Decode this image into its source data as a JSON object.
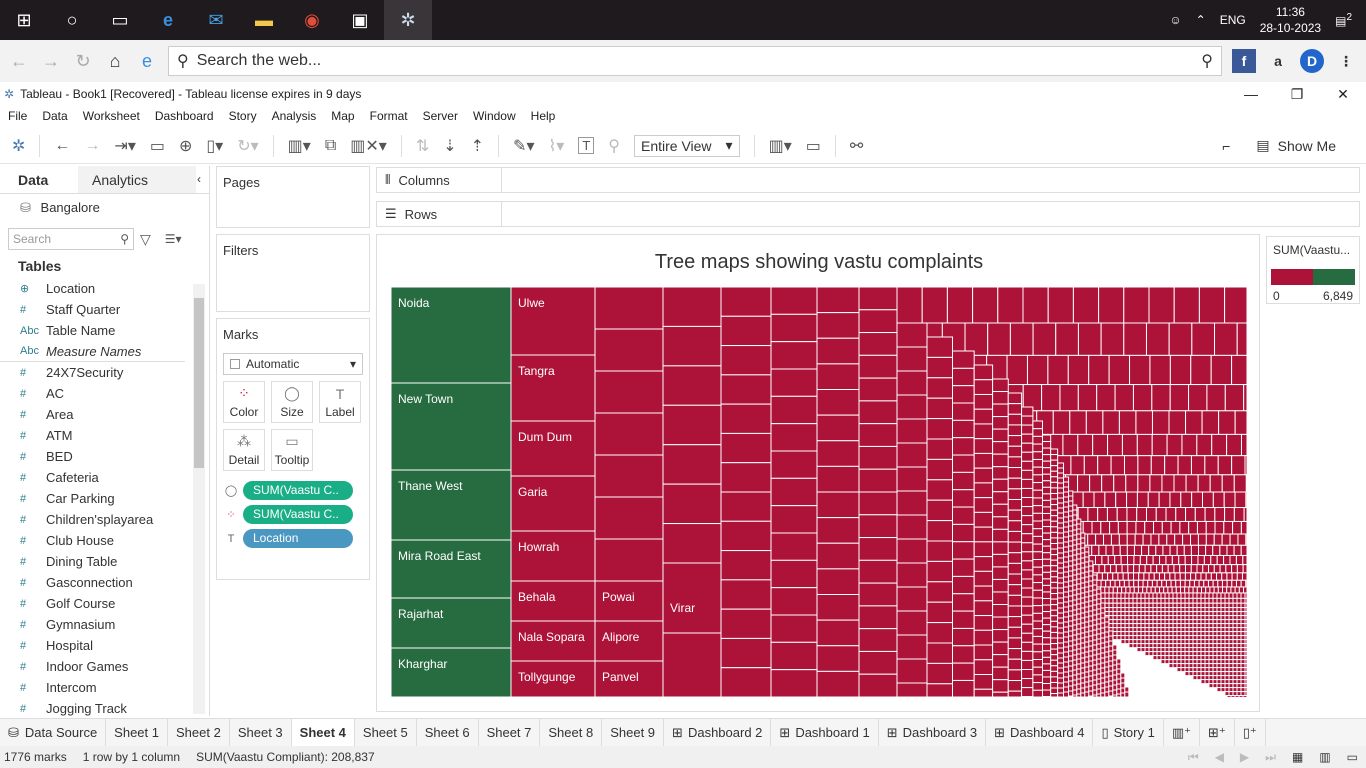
{
  "taskbar": {
    "lang": "ENG",
    "time": "11:36",
    "date": "28-10-2023",
    "notifications": "2"
  },
  "browser": {
    "search_placeholder": "Search the web..."
  },
  "window": {
    "title": "Tableau - Book1 [Recovered] - Tableau license expires in 9 days"
  },
  "menu": [
    "File",
    "Data",
    "Worksheet",
    "Dashboard",
    "Story",
    "Analysis",
    "Map",
    "Format",
    "Server",
    "Window",
    "Help"
  ],
  "toolbar": {
    "view": "Entire View",
    "show_me": "Show Me"
  },
  "datapane": {
    "tab_data": "Data",
    "tab_analytics": "Analytics",
    "source": "Bangalore",
    "search_placeholder": "Search",
    "tables_heading": "Tables",
    "fields": [
      {
        "icon": "globe",
        "name": "Location"
      },
      {
        "icon": "#",
        "name": "Staff Quarter"
      },
      {
        "icon": "Abc",
        "name": "Table Name"
      },
      {
        "icon": "Abc",
        "name": "Measure Names"
      },
      {
        "icon": "#",
        "name": "24X7Security"
      },
      {
        "icon": "#",
        "name": "AC"
      },
      {
        "icon": "#",
        "name": "Area"
      },
      {
        "icon": "#",
        "name": "ATM"
      },
      {
        "icon": "#",
        "name": "BED"
      },
      {
        "icon": "#",
        "name": "Cafeteria"
      },
      {
        "icon": "#",
        "name": "Car Parking"
      },
      {
        "icon": "#",
        "name": "Children'splayarea"
      },
      {
        "icon": "#",
        "name": "Club House"
      },
      {
        "icon": "#",
        "name": "Dining Table"
      },
      {
        "icon": "#",
        "name": "Gasconnection"
      },
      {
        "icon": "#",
        "name": "Golf Course"
      },
      {
        "icon": "#",
        "name": "Gymnasium"
      },
      {
        "icon": "#",
        "name": "Hospital"
      },
      {
        "icon": "#",
        "name": "Indoor Games"
      },
      {
        "icon": "#",
        "name": "Intercom"
      },
      {
        "icon": "#",
        "name": "Jogging Track"
      }
    ]
  },
  "shelves": {
    "pages": "Pages",
    "filters": "Filters",
    "marks": "Marks",
    "mark_type": "Automatic",
    "mark_buttons": [
      "Color",
      "Size",
      "Label",
      "Detail",
      "Tooltip"
    ],
    "pills": [
      "SUM(Vaastu C..",
      "SUM(Vaastu C..",
      "Location"
    ],
    "columns": "Columns",
    "rows": "Rows"
  },
  "viz": {
    "title": "Tree maps showing vastu complaints",
    "colors": {
      "low": "#ad1339",
      "high": "#276b40"
    },
    "labels": [
      "Noida",
      "New Town",
      "Thane West",
      "Mira Road East",
      "Rajarhat",
      "Kharghar",
      "Ulwe",
      "Tangra",
      "Dum Dum",
      "Garia",
      "Howrah",
      "Behala",
      "Nala Sopara",
      "Tollygunge",
      "Powai",
      "Alipore",
      "Panvel",
      "Virar"
    ]
  },
  "legend": {
    "title": "SUM(Vaastu...",
    "min": "0",
    "max": "6,849"
  },
  "sheet_tabs": [
    "Data Source",
    "Sheet 1",
    "Sheet 2",
    "Sheet 3",
    "Sheet 4",
    "Sheet 5",
    "Sheet 6",
    "Sheet 7",
    "Sheet 8",
    "Sheet 9",
    "Dashboard 2",
    "Dashboard 1",
    "Dashboard 3",
    "Dashboard 4",
    "Story 1"
  ],
  "status": {
    "marks": "1776 marks",
    "rowscols": "1 row by 1 column",
    "sum": "SUM(Vaastu Compliant): 208,837"
  }
}
